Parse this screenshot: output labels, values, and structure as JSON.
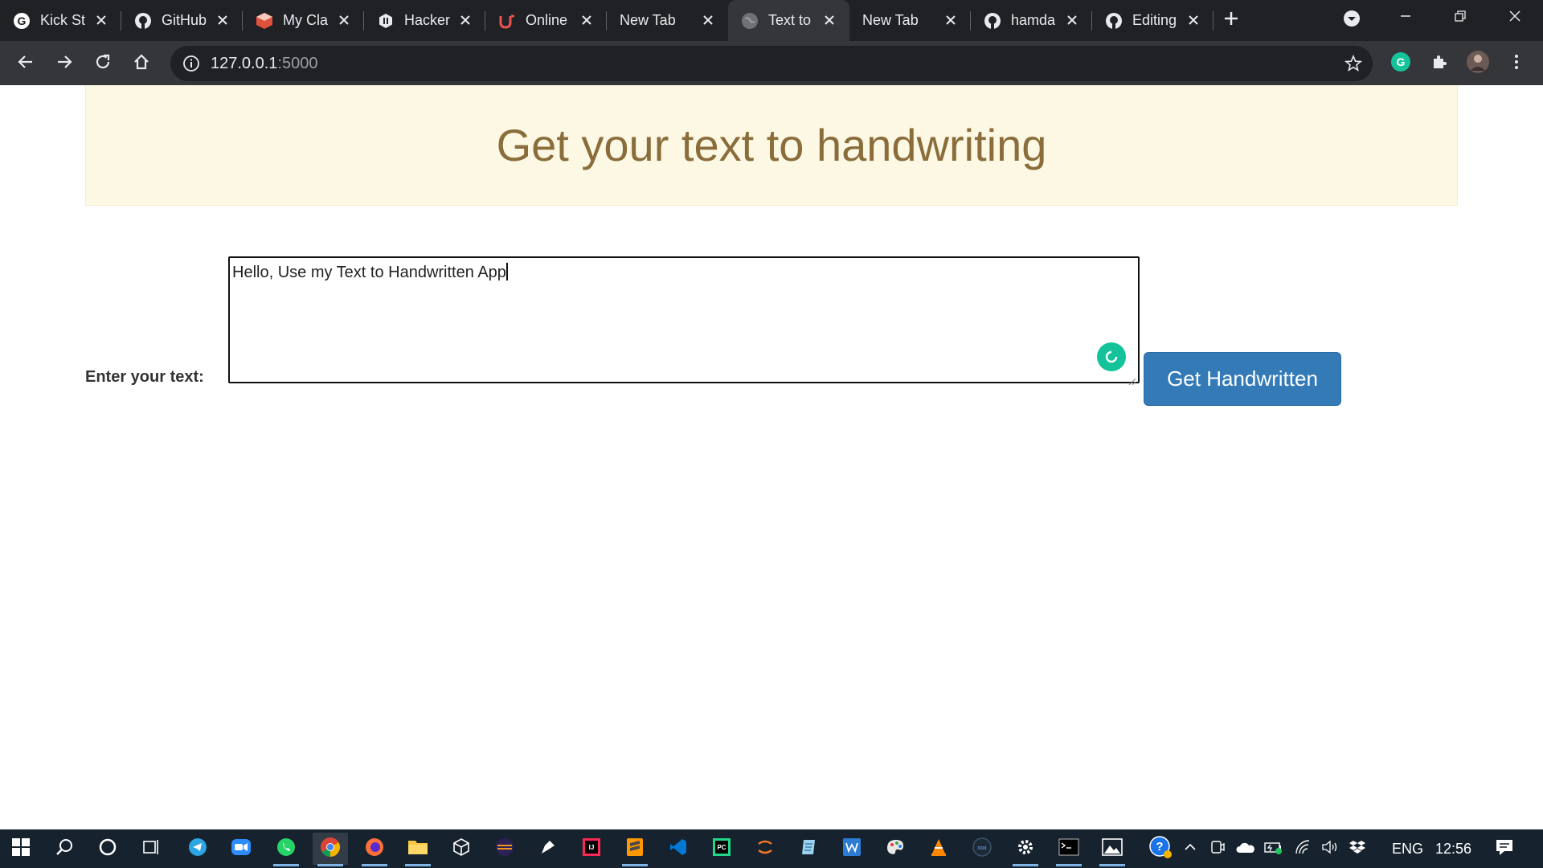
{
  "browser": {
    "tabs": [
      {
        "title": "Kick St",
        "icon": "google-icon"
      },
      {
        "title": "GitHub",
        "icon": "github-icon"
      },
      {
        "title": "My Cla",
        "icon": "classroom-icon"
      },
      {
        "title": "Hacker",
        "icon": "hackerrank-icon"
      },
      {
        "title": "Online",
        "icon": "udemy-icon"
      },
      {
        "title": "New Tab",
        "icon": ""
      },
      {
        "title": "Text to",
        "icon": "globe-icon",
        "active": true
      },
      {
        "title": "New Tab",
        "icon": ""
      },
      {
        "title": "hamda",
        "icon": "github-icon"
      },
      {
        "title": "Editing",
        "icon": "github-icon"
      }
    ],
    "address": {
      "host": "127.0.0.1",
      "port": ":5000"
    }
  },
  "page": {
    "heading": "Get your text to handwriting",
    "label": "Enter your text:",
    "textarea_value": "Hello, Use my Text to Handwritten App",
    "button": "Get Handwritten"
  },
  "taskbar": {
    "language": "ENG",
    "time": "12:56"
  },
  "colors": {
    "jumbotron_bg": "#fcf8e3",
    "heading": "#8a6d3b",
    "button": "#337ab7",
    "grammarly": "#15c39a"
  }
}
